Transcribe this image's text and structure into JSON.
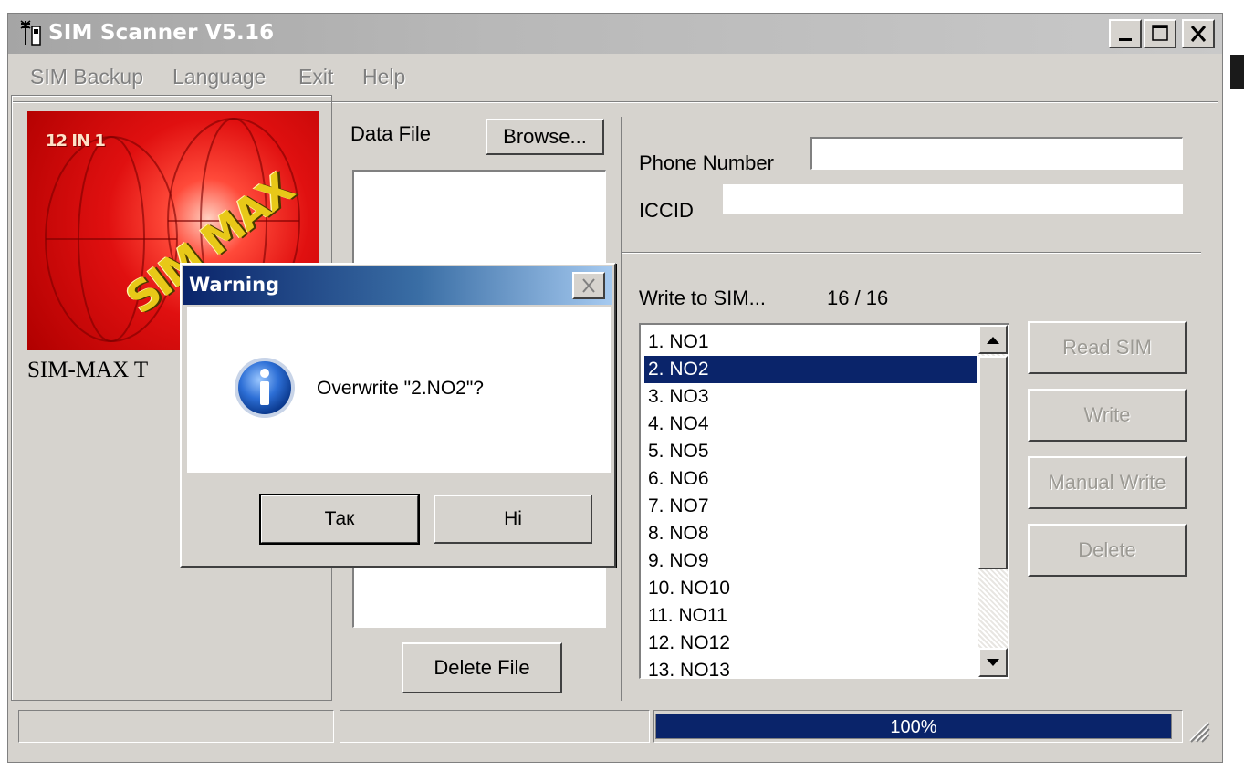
{
  "window": {
    "title": "SIM Scanner V5.16",
    "title_icon": "antenna-phone-icon"
  },
  "menu": [
    "SIM Backup",
    "Language",
    "Exit",
    "Help"
  ],
  "logo": {
    "badge": "12 IN 1",
    "brand": "SIM MAX",
    "caption": "SIM-MAX T"
  },
  "data_file": {
    "label": "Data File",
    "browse_label": "Browse...",
    "delete_label": "Delete File"
  },
  "fields": {
    "phone_label": "Phone Number",
    "phone_value": "",
    "iccid_label": "ICCID",
    "iccid_value": ""
  },
  "write": {
    "label": "Write to SIM...",
    "count": "16 / 16"
  },
  "list": {
    "items": [
      "1. NO1",
      "2. NO2",
      "3. NO3",
      "4. NO4",
      "5. NO5",
      "6. NO6",
      "7. NO7",
      "8. NO8",
      "9. NO9",
      "10. NO10",
      "11. NO11",
      "12. NO12",
      "13. NO13"
    ],
    "selected_index": 1
  },
  "side_buttons": {
    "read": "Read SIM",
    "write": "Write",
    "manual": "Manual Write",
    "delete": "Delete"
  },
  "status": {
    "progress_text": "100%",
    "progress_value": 1.0
  },
  "dialog": {
    "title": "Warning",
    "icon": "info-icon",
    "message": "Overwrite \"2.NO2\"?",
    "yes_label": "Так",
    "no_label": "Hi"
  },
  "colors": {
    "face": "#d6d3ce",
    "selection": "#0a246a",
    "dialog_title": "#0a246a",
    "logo_red": "#e01010"
  }
}
